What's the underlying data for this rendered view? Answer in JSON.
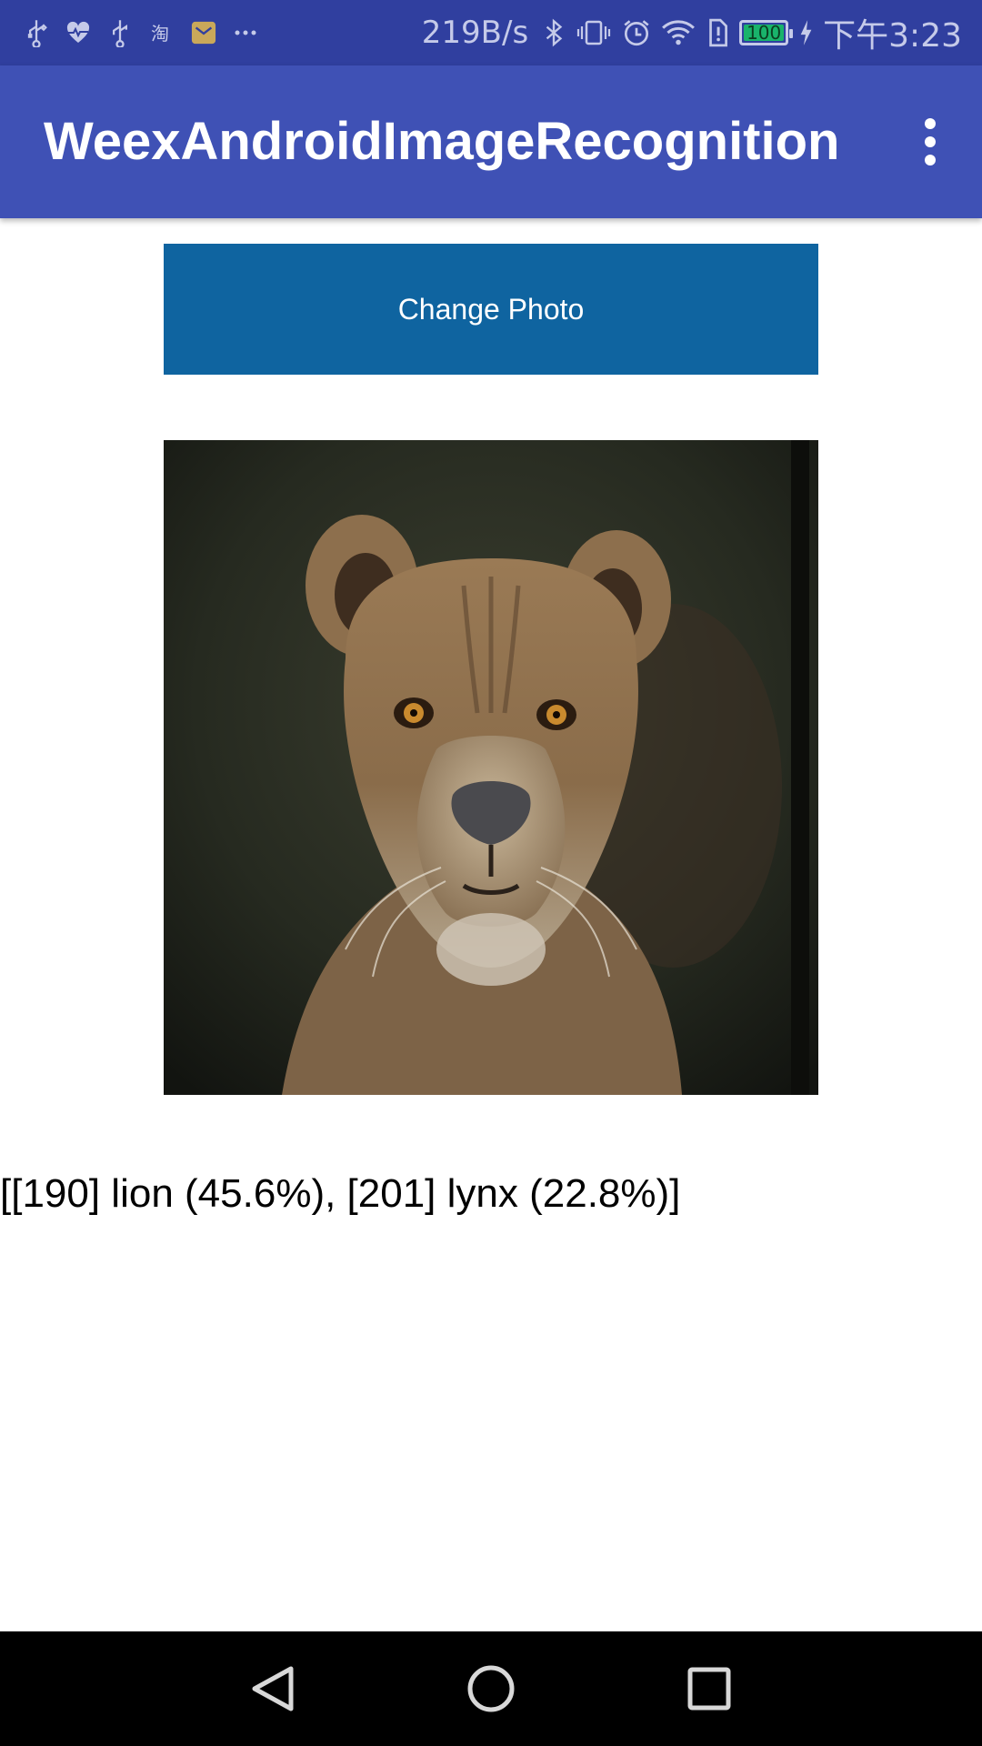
{
  "status_bar": {
    "left_icons": [
      "usb-icon",
      "heart-pulse-icon",
      "usb-icon",
      "taobao-icon",
      "mail-icon",
      "more-dots-icon"
    ],
    "net_speed": "219B/s",
    "right_icons": [
      "bluetooth-icon",
      "vibrate-icon",
      "alarm-icon",
      "wifi-icon",
      "sim-alert-icon"
    ],
    "battery": {
      "level": 100,
      "label": "100",
      "charging": true,
      "color": "#19b36b"
    },
    "clock": "下午3:23"
  },
  "app_bar": {
    "title": "WeexAndroidImageRecognition",
    "menu_icon": "more-vert-icon",
    "color": "#3f51b5"
  },
  "main": {
    "change_photo_label": "Change Photo",
    "button_color": "#0f64a0",
    "photo_subject": "lioness",
    "result_text": "[[190] lion (45.6%), [201] lynx (22.8%)]"
  },
  "nav_bar": {
    "buttons": [
      "back-icon",
      "home-icon",
      "recents-icon"
    ]
  }
}
